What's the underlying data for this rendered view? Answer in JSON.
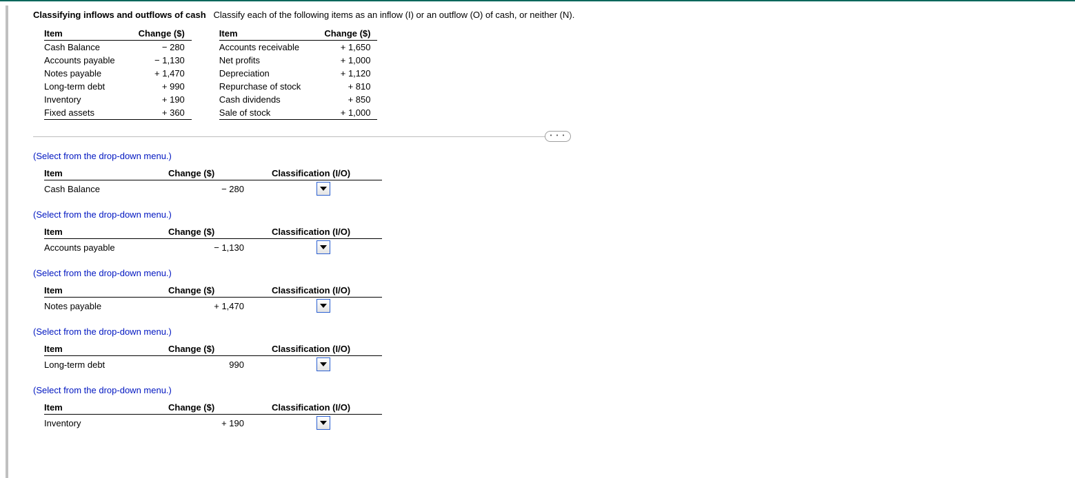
{
  "heading": {
    "bold": "Classifying inflows and outflows of cash",
    "rest": "Classify each of the following items as an inflow (I) or an outflow (O) of cash, or neither (N)."
  },
  "ref_headers": {
    "item": "Item",
    "change": "Change ($)"
  },
  "ref_left": [
    {
      "item": "Cash Balance",
      "change": "− 280"
    },
    {
      "item": "Accounts payable",
      "change": "− 1,130"
    },
    {
      "item": "Notes payable",
      "change": "+ 1,470"
    },
    {
      "item": "Long-term debt",
      "change": "+ 990"
    },
    {
      "item": "Inventory",
      "change": "+ 190"
    },
    {
      "item": "Fixed assets",
      "change": "+ 360"
    }
  ],
  "ref_right": [
    {
      "item": "Accounts receivable",
      "change": "+ 1,650"
    },
    {
      "item": "Net profits",
      "change": "+ 1,000"
    },
    {
      "item": "Depreciation",
      "change": "+ 1,120"
    },
    {
      "item": "Repurchase of stock",
      "change": "+ 810"
    },
    {
      "item": "Cash dividends",
      "change": "+ 850"
    },
    {
      "item": "Sale of stock",
      "change": "+ 1,000"
    }
  ],
  "divider_pill": "• • •",
  "instr": "(Select from the drop-down menu.)",
  "cls_headers": {
    "item": "Item",
    "change": "Change ($)",
    "class": "Classification (I/O)"
  },
  "blocks": [
    {
      "item": "Cash Balance",
      "change": "− 280"
    },
    {
      "item": "Accounts payable",
      "change": "− 1,130"
    },
    {
      "item": "Notes payable",
      "change": "+ 1,470"
    },
    {
      "item": "Long-term debt",
      "change": "990"
    },
    {
      "item": "Inventory",
      "change": "+ 190"
    }
  ]
}
